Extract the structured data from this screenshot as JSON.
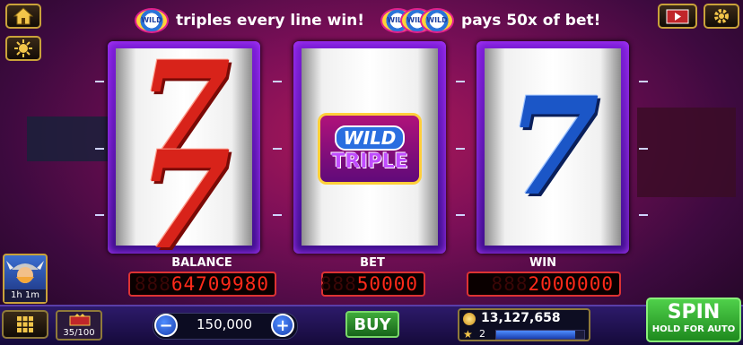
{
  "top": {
    "home_icon": "home-icon",
    "settings_icon": "gear-icon",
    "menu_icon": "sun-icon",
    "video_icon": "film-icon",
    "msg_part1": "triples every line win!",
    "msg_part2": "pays 50x of bet!",
    "badge_text": "WILD"
  },
  "reels": [
    {
      "symbol": "7",
      "color": "#d8231a"
    },
    {
      "symbol_line1": "WILD",
      "symbol_line2": "TRIPLE"
    },
    {
      "symbol": "7",
      "color": "#1b56c7"
    }
  ],
  "meters": {
    "balance_label": "BALANCE",
    "balance_value": "64709980",
    "balance_lead": "888",
    "bet_label": "BET",
    "bet_value": "50000",
    "bet_lead": "888",
    "win_label": "WIN",
    "win_value": "2000000",
    "win_lead": "888"
  },
  "player": {
    "timer": "1h  1m"
  },
  "bottom": {
    "level_progress": "35/100",
    "bet_amount": "150,000",
    "minus": "−",
    "plus": "+",
    "buy_label": "BUY",
    "coins": "13,127,658",
    "level": "2",
    "spin_label": "SPIN",
    "spin_sub": "HOLD FOR AUTO"
  },
  "colors": {
    "accent_gold": "#c9a23a",
    "spin_green": "#2fae2f",
    "meter_red": "#ff2a1a"
  }
}
